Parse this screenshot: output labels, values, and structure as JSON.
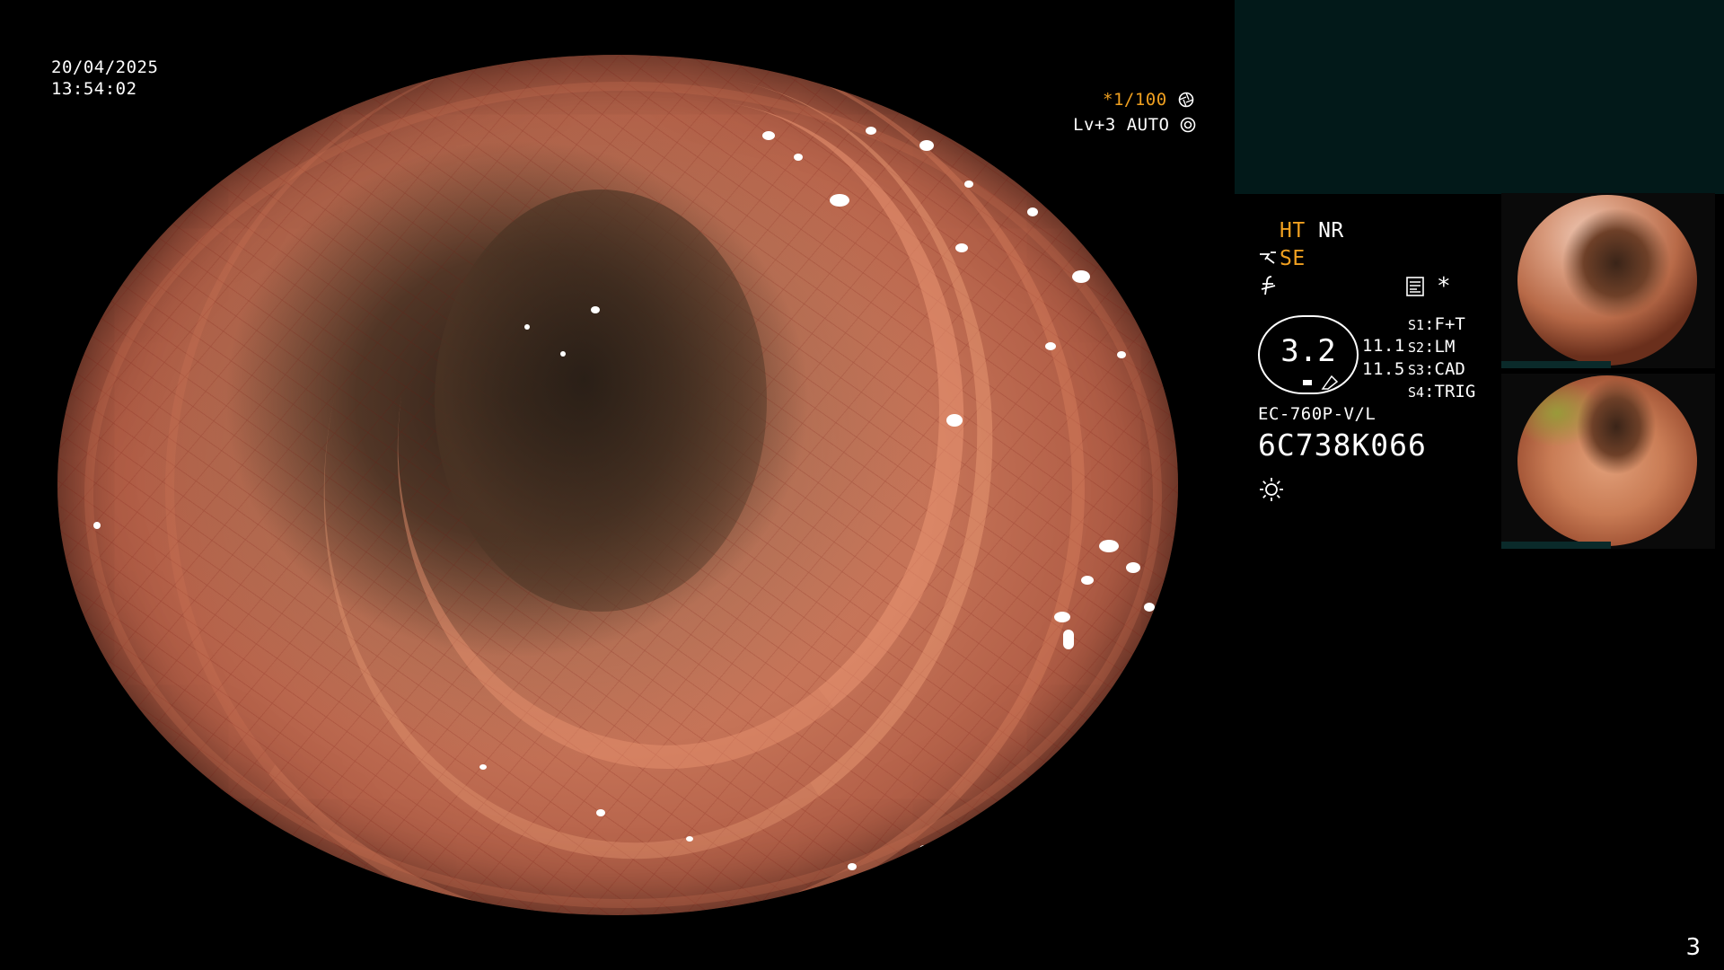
{
  "overlay": {
    "date": "20/04/2025",
    "time": "13:54:02",
    "shutter": "*1/100",
    "shutter_icon": "aperture-icon",
    "level": "Lv+3",
    "exposure_mode": "AUTO",
    "exposure_icon": "exposure-dial-icon"
  },
  "modes": {
    "ht": "HT",
    "nr": "NR",
    "se": "SE",
    "struct_icon": "structure-enhance-icon",
    "f_icon": "f-icon",
    "chart_icon": "recording-icon",
    "star": "*"
  },
  "brightness": {
    "value": "3.2",
    "reading_a": "11.1",
    "reading_b": "11.5"
  },
  "switches": [
    {
      "key": "S1",
      "label": "F+T"
    },
    {
      "key": "S2",
      "label": "LM"
    },
    {
      "key": "S3",
      "label": "CAD"
    },
    {
      "key": "S4",
      "label": "TRIG"
    }
  ],
  "device": {
    "model": "EC-760P-V/L",
    "serial": "6C738K066",
    "light_icon": "sun-icon"
  },
  "page_number": "3",
  "colors": {
    "accent_orange": "#f0a020",
    "panel_dark_teal": "#021919"
  }
}
